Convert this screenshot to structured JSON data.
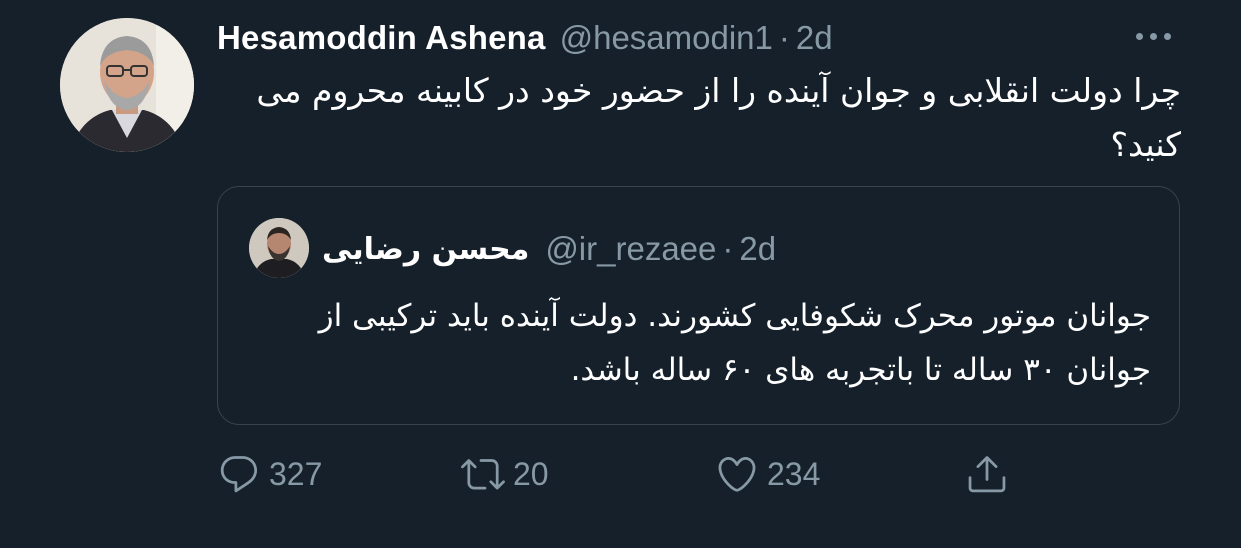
{
  "tweet": {
    "author_name": "Hesamoddin Ashena",
    "author_handle": "@hesamodin1",
    "separator": "·",
    "time": "2d",
    "text": "چرا دولت انقلابی و جوان آینده را از حضور خود در کابینه محروم می کنید؟",
    "more_icon": "more-icon"
  },
  "quote": {
    "author_name": "محسن رضایی",
    "author_handle": "@ir_rezaee",
    "separator": "·",
    "time": "2d",
    "text": "جوانان موتور محرک شکوفایی کشورند. دولت آینده باید ترکیبی از جوانان ۳۰ ساله تا باتجربه های ۶۰ ساله باشد."
  },
  "actions": {
    "reply": {
      "icon": "reply-icon",
      "count": "327"
    },
    "retweet": {
      "icon": "retweet-icon",
      "count": "20"
    },
    "like": {
      "icon": "heart-icon",
      "count": "234"
    },
    "share": {
      "icon": "share-icon"
    }
  },
  "colors": {
    "background": "#15202b",
    "secondary_text": "#8899a6",
    "border": "#38444d",
    "primary_text": "#ffffff"
  }
}
